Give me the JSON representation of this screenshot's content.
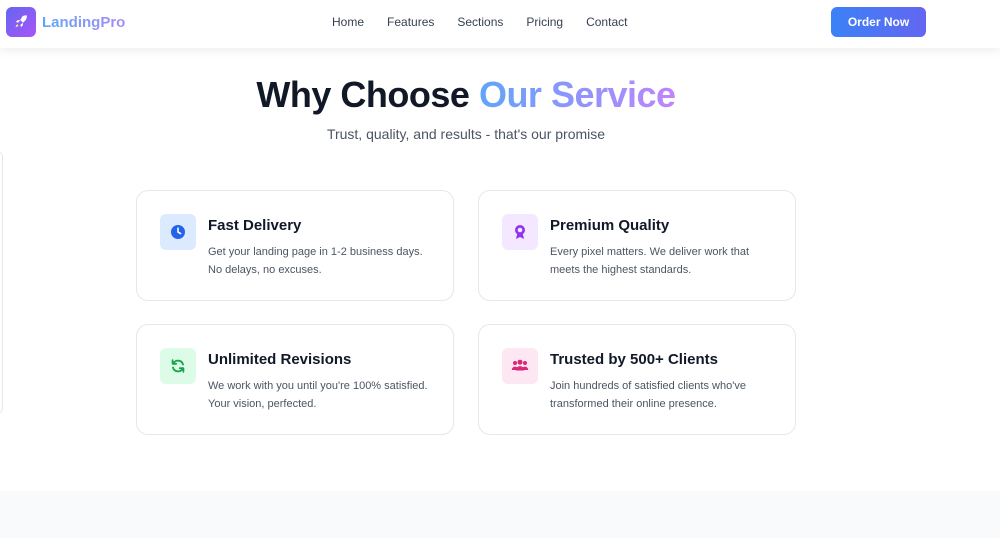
{
  "header": {
    "brand": "LandingPro",
    "nav": [
      "Home",
      "Features",
      "Sections",
      "Pricing",
      "Contact"
    ],
    "cta_label": "Order Now"
  },
  "hero": {
    "title_main": "Why Choose ",
    "title_accent": "Our Service",
    "subtitle": "Trust, quality, and results - that's our promise"
  },
  "features": [
    {
      "title": "Fast Delivery",
      "description": "Get your landing page in 1-2 business days. No delays, no excuses.",
      "icon": "clock-icon",
      "color": "#2563eb",
      "bg": "#dbeafe"
    },
    {
      "title": "Premium Quality",
      "description": "Every pixel matters. We deliver work that meets the highest standards.",
      "icon": "award-icon",
      "color": "#9333ea",
      "bg": "#f3e8ff"
    },
    {
      "title": "Unlimited Revisions",
      "description": "We work with you until you're 100% satisfied. Your vision, perfected.",
      "icon": "refresh-icon",
      "color": "#16a34a",
      "bg": "#dcfce7"
    },
    {
      "title": "Trusted by 500+ Clients",
      "description": "Join hundreds of satisfied clients who've transformed their online presence.",
      "icon": "users-icon",
      "color": "#db2777",
      "bg": "#fce7f3"
    }
  ]
}
